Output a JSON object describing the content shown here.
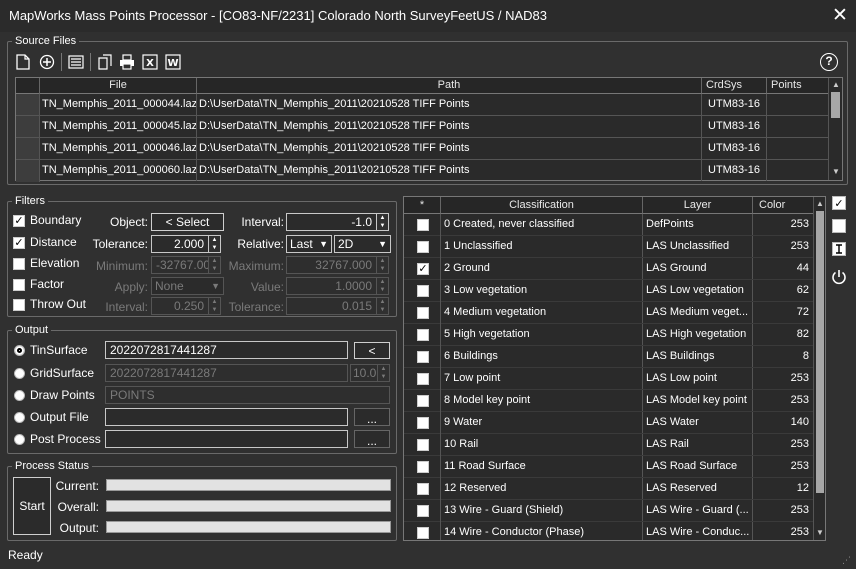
{
  "window": {
    "title": "MapWorks Mass Points Processor - [CO83-NF/2231] Colorado North SurveyFeetUS / NAD83",
    "close_glyph": "✕"
  },
  "source_files": {
    "label": "Source Files",
    "columns": [
      "File",
      "Path",
      "CrdSys",
      "Points"
    ],
    "rows": [
      {
        "file": "TN_Memphis_2011_000044.laz",
        "path": "D:\\UserData\\TN_Memphis_2011\\20210528 TIFF Points",
        "crdsys": "UTM83-16",
        "points": ""
      },
      {
        "file": "TN_Memphis_2011_000045.laz",
        "path": "D:\\UserData\\TN_Memphis_2011\\20210528 TIFF Points",
        "crdsys": "UTM83-16",
        "points": ""
      },
      {
        "file": "TN_Memphis_2011_000046.laz",
        "path": "D:\\UserData\\TN_Memphis_2011\\20210528 TIFF Points",
        "crdsys": "UTM83-16",
        "points": ""
      },
      {
        "file": "TN_Memphis_2011_000060.laz",
        "path": "D:\\UserData\\TN_Memphis_2011\\20210528 TIFF Points",
        "crdsys": "UTM83-16",
        "points": ""
      }
    ],
    "toolbar_icons": [
      "new-file-icon",
      "add-icon",
      "list-icon",
      "copy-icon",
      "print-icon",
      "excel-icon",
      "word-icon",
      "help-icon"
    ],
    "help_glyph": "?"
  },
  "filters": {
    "label": "Filters",
    "boundary": {
      "label": "Boundary",
      "checked": true
    },
    "distance": {
      "label": "Distance",
      "checked": true
    },
    "elevation": {
      "label": "Elevation",
      "checked": false
    },
    "factor": {
      "label": "Factor",
      "checked": false
    },
    "throw_out": {
      "label": "Throw Out",
      "checked": false
    },
    "object_label": "Object:",
    "select_button": "< Select",
    "interval_label": "Interval:",
    "interval_value": "-1.0",
    "tolerance_label": "Tolerance:",
    "tolerance_value": "2.000",
    "relative_label": "Relative:",
    "relative_value": "Last",
    "relative_dim": "2D",
    "minimum_label": "Minimum:",
    "minimum_value": "-32767.000",
    "maximum_label": "Maximum:",
    "maximum_value": "32767.000",
    "apply_label": "Apply:",
    "apply_value": "None",
    "value_label": "Value:",
    "value_value": "1.0000",
    "interval2_label": "Interval:",
    "interval2_value": "0.250",
    "tolerance2_label": "Tolerance:",
    "tolerance2_value": "0.015"
  },
  "output": {
    "label": "Output",
    "tin": {
      "label": "TinSurface",
      "value": "2022072817441287",
      "selected": true,
      "button": "<"
    },
    "grid": {
      "label": "GridSurface",
      "value": "2022072817441287",
      "spacing": "10.0"
    },
    "draw": {
      "label": "Draw Points",
      "value": "POINTS"
    },
    "file": {
      "label": "Output File",
      "value": "",
      "button": "..."
    },
    "post": {
      "label": "Post Process",
      "value": "",
      "button": "..."
    }
  },
  "process": {
    "label": "Process Status",
    "start": "Start",
    "current_label": "Current:",
    "overall_label": "Overall:",
    "output_label": "Output:",
    "current_progress": 0,
    "overall_progress": 0,
    "output_progress": 0
  },
  "classes": {
    "columns": [
      "*",
      "Classification",
      "Layer",
      "Color"
    ],
    "rows": [
      {
        "checked": false,
        "name": "0 Created, never classified",
        "layer": "DefPoints",
        "color": "253"
      },
      {
        "checked": false,
        "name": "1 Unclassified",
        "layer": "LAS Unclassified",
        "color": "253"
      },
      {
        "checked": true,
        "name": "2 Ground",
        "layer": "LAS Ground",
        "color": "44"
      },
      {
        "checked": false,
        "name": "3 Low vegetation",
        "layer": "LAS Low vegetation",
        "color": "62"
      },
      {
        "checked": false,
        "name": "4 Medium vegetation",
        "layer": "LAS Medium veget...",
        "color": "72"
      },
      {
        "checked": false,
        "name": "5 High vegetation",
        "layer": "LAS High vegetation",
        "color": "82"
      },
      {
        "checked": false,
        "name": "6 Buildings",
        "layer": "LAS Buildings",
        "color": "8"
      },
      {
        "checked": false,
        "name": "7 Low point",
        "layer": "LAS Low point",
        "color": "253"
      },
      {
        "checked": false,
        "name": "8 Model key point",
        "layer": "LAS Model key point",
        "color": "253"
      },
      {
        "checked": false,
        "name": "9 Water",
        "layer": "LAS Water",
        "color": "140"
      },
      {
        "checked": false,
        "name": "10 Rail",
        "layer": "LAS Rail",
        "color": "253"
      },
      {
        "checked": false,
        "name": "11 Road Surface",
        "layer": "LAS Road Surface",
        "color": "253"
      },
      {
        "checked": false,
        "name": "12 Reserved",
        "layer": "LAS Reserved",
        "color": "12"
      },
      {
        "checked": false,
        "name": "13 Wire - Guard (Shield)",
        "layer": "LAS Wire - Guard (...",
        "color": "253"
      },
      {
        "checked": false,
        "name": "14 Wire - Conductor (Phase)",
        "layer": "LAS Wire - Conduc...",
        "color": "253"
      }
    ]
  },
  "side_icons": [
    "check-all-icon",
    "uncheck-all-icon",
    "invert-icon",
    "power-icon"
  ],
  "status_bar": {
    "text": "Ready"
  }
}
